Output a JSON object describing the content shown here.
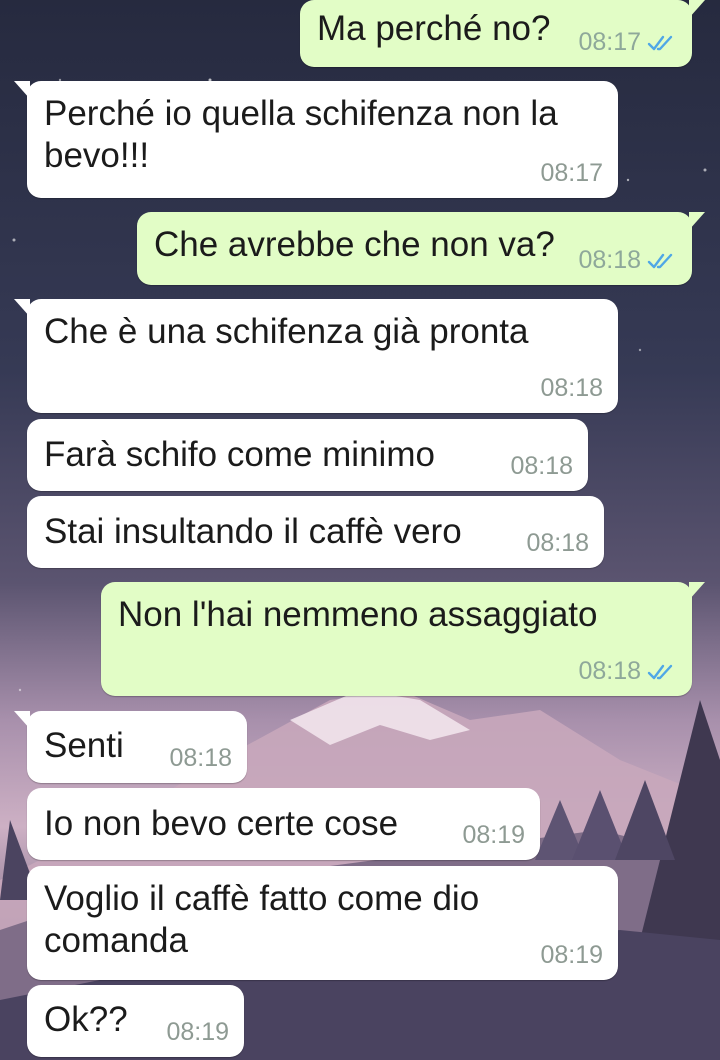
{
  "colors": {
    "incoming_bubble": "#ffffff",
    "outgoing_bubble": "#e2fdc6",
    "read_ticks": "#4fa7e6",
    "wallpaper_sky_top": "#262a3f",
    "wallpaper_sky_bottom": "#cdb0c4"
  },
  "messages": [
    {
      "direction": "out",
      "text": "Ma perché no?",
      "time": "08:17",
      "status": "read-ticks-icon"
    },
    {
      "direction": "in",
      "text": "Perché io quella schifenza non la\nbevo!!!",
      "time": "08:17"
    },
    {
      "direction": "out",
      "text": "Che avrebbe che non va?",
      "time": "08:18",
      "status": "read-ticks-icon"
    },
    {
      "direction": "in",
      "text": "Che è una schifenza già pronta",
      "time": "08:18"
    },
    {
      "direction": "in",
      "text": "Farà schifo come minimo",
      "time": "08:18"
    },
    {
      "direction": "in",
      "text": "Stai insultando il caffè vero",
      "time": "08:18"
    },
    {
      "direction": "out",
      "text": "Non l'hai nemmeno assaggiato",
      "time": "08:18",
      "status": "read-ticks-icon"
    },
    {
      "direction": "in",
      "text": "Senti",
      "time": "08:18"
    },
    {
      "direction": "in",
      "text": "Io non bevo certe cose",
      "time": "08:19"
    },
    {
      "direction": "in",
      "text": "Voglio il caffè fatto come dio\ncomanda",
      "time": "08:19"
    },
    {
      "direction": "in",
      "text": "Ok??",
      "time": "08:19"
    }
  ]
}
